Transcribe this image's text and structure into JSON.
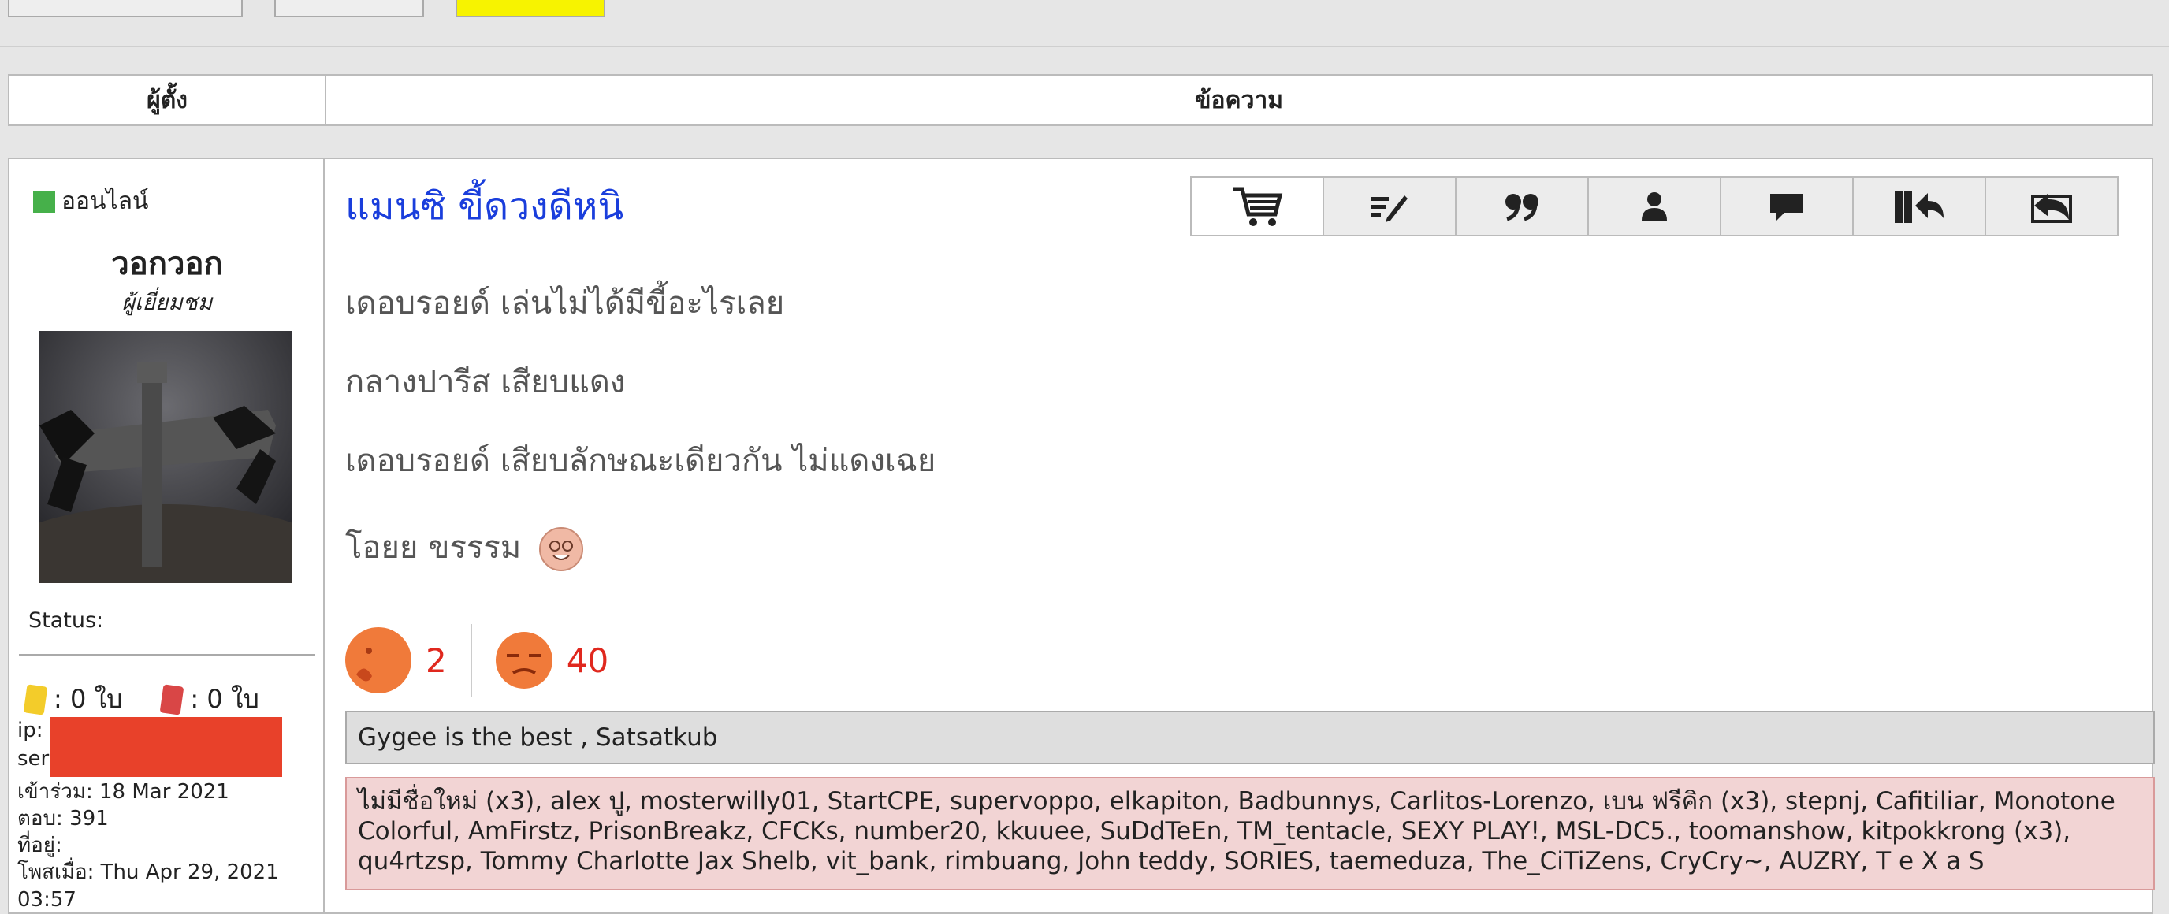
{
  "header": {
    "col_author": "ผู้ตั้ง",
    "col_message": "ข้อความ"
  },
  "user": {
    "online_label": "ออนไลน์",
    "name": "วอกวอก",
    "rank": "ผู้เยี่ยมชม",
    "status_label": "Status:",
    "yellow_cards": ": 0 ใบ",
    "red_cards": ": 0 ใบ",
    "ip_label": "ip:",
    "server_label": "ser",
    "joined": "เข้าร่วม: 18 Mar 2021",
    "replies": "ตอบ: 391",
    "location": "ที่อยู่:",
    "posted": "โพสเมื่อ: Thu Apr 29, 2021 03:57"
  },
  "post": {
    "title": "แมนซิ ขี้ดวงดีหนิ",
    "lines": [
      "เดอบรอยด์ เล่นไม่ได้มีขี้อะไรเลย",
      "กลางปารีส เสียบแดง",
      "เดอบรอยด์ เสียบลักษณะเดียวกัน ไม่แดงเฉย",
      "โอยย ขรรรม"
    ],
    "reactions": {
      "like_count": "2",
      "dislike_count": "40"
    },
    "signature": "Gygee is the best , Satsatkub",
    "likers": "ไม่มีชื่อใหม่ (x3), alex ปู, mosterwilly01, StartCPE, supervoppo, elkapiton, Badbunnys, Carlitos-Lorenzo, เบน ฟรีคิก (x3), stepnj, Cafitiliar, Monotone Colorful, AmFirstz, PrisonBreakz, CFCKs, number20, kkuuee, SuDdTeEn, TM_tentacle, SEXY PLAY!, MSL-DC5., toomanshow, kitpokkrong (x3), qu4rtzsp, Tommy Charlotte Jax Shelb, vit_bank, rimbuang, John teddy, SORIES, taemeduza, The_CiTiZens, CryCry~, AUZRY, T e X a S"
  },
  "icons": [
    "cart-icon",
    "edit-icon",
    "quote-icon",
    "profile-icon",
    "message-icon",
    "report-icon",
    "reply-icon"
  ],
  "colors": {
    "title": "#1a3edc",
    "online": "#46b04a",
    "reaction_count": "#e0281e",
    "signature_bg": "#dedede",
    "likers_bg": "#f2d4d4",
    "top_button_highlight": "#f7f300"
  }
}
